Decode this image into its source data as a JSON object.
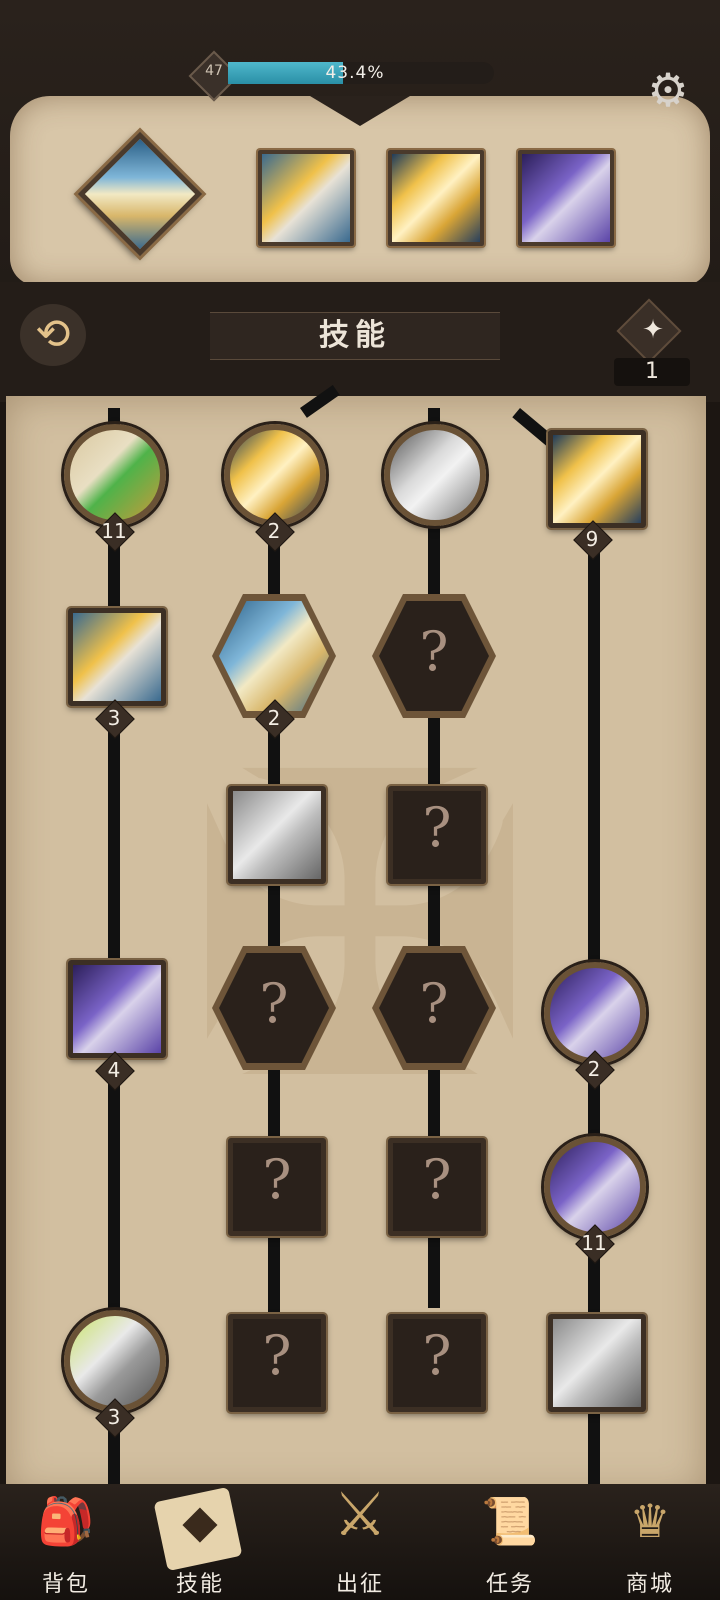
{
  "header": {
    "level": "47",
    "xp_percent_text": "43.4%",
    "xp_fraction": 0.434,
    "settings_icon": "gear-icon"
  },
  "equipped": [
    {
      "art": "holy-knight"
    },
    {
      "art": "light-beam-figure"
    },
    {
      "art": "golden-burst"
    },
    {
      "art": "purple-mage"
    }
  ],
  "skills_panel": {
    "title": "技能",
    "points": "1",
    "swap_icon": "refresh-arrows-icon",
    "points_icon": "diamond-star-icon"
  },
  "tree": {
    "nodes": [
      {
        "col": 0,
        "shape": "circle",
        "art": "healing-cross",
        "level": "11"
      },
      {
        "col": 1,
        "shape": "circle",
        "art": "winged-helm",
        "level": "2"
      },
      {
        "col": 2,
        "shape": "circle",
        "art": "silver-sword",
        "level": ""
      },
      {
        "col": 3,
        "shape": "square",
        "art": "golden-burst",
        "level": "9"
      },
      {
        "col": 0,
        "shape": "square",
        "art": "light-beam-figure",
        "level": "3"
      },
      {
        "col": 1,
        "shape": "hex",
        "art": "holy-knight",
        "level": "2"
      },
      {
        "col": 2,
        "shape": "hex",
        "art": "locked",
        "level": "?"
      },
      {
        "col": 1,
        "shape": "square",
        "art": "chains-gray",
        "level": ""
      },
      {
        "col": 2,
        "shape": "square",
        "art": "locked",
        "level": "?"
      },
      {
        "col": 0,
        "shape": "square",
        "art": "purple-mage",
        "level": "4"
      },
      {
        "col": 1,
        "shape": "hex",
        "art": "locked",
        "level": "?"
      },
      {
        "col": 2,
        "shape": "hex",
        "art": "locked",
        "level": "?"
      },
      {
        "col": 3,
        "shape": "circle",
        "art": "purple-chains",
        "level": "2"
      },
      {
        "col": 1,
        "shape": "square",
        "art": "locked",
        "level": "?"
      },
      {
        "col": 2,
        "shape": "square",
        "art": "locked",
        "level": "?"
      },
      {
        "col": 3,
        "shape": "circle",
        "art": "purple-hand",
        "level": "11"
      },
      {
        "col": 0,
        "shape": "circle",
        "art": "cracked-stone",
        "level": "3"
      },
      {
        "col": 1,
        "shape": "square",
        "art": "locked",
        "level": "?"
      },
      {
        "col": 2,
        "shape": "square",
        "art": "locked",
        "level": "?"
      },
      {
        "col": 3,
        "shape": "square",
        "art": "silver-armor",
        "level": ""
      }
    ]
  },
  "nav": [
    {
      "label": "背包",
      "icon": "backpack-icon"
    },
    {
      "label": "技能",
      "icon": "skill-book-icon",
      "active": true
    },
    {
      "label": "出征",
      "icon": "sword-banner-icon"
    },
    {
      "label": "任务",
      "icon": "scroll-icon"
    },
    {
      "label": "商城",
      "icon": "shop-crown-icon"
    }
  ]
}
